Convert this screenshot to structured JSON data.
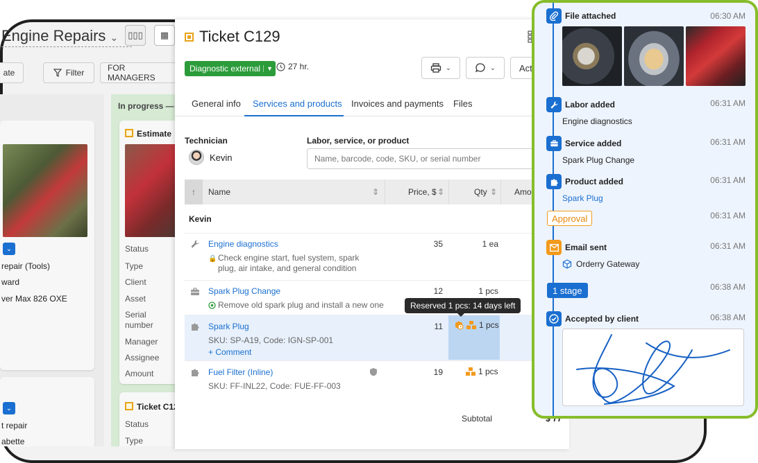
{
  "board": {
    "title": "Engine Repairs",
    "caret": "⌄",
    "view_kanban": "▯▯▯",
    "view_table": "▦",
    "btn_partial": "ate",
    "filter_label": "Filter",
    "managers_label": "FOR MANAGERS",
    "column_in_progress": "In progress —",
    "card_estimate": "Estimate",
    "card_ticket_prefix": "Ticket C12",
    "left_lines": [
      "repair (Tools)",
      "ward",
      "ver Max 826 OXE"
    ],
    "left_bottom_lines": [
      "t repair",
      "abette"
    ],
    "field_labels": [
      "Status",
      "Type",
      "Client",
      "Asset",
      "Serial",
      "number",
      "Manager",
      "Assignee",
      "Amount"
    ],
    "field_labels_bottom": [
      "Status",
      "Type"
    ]
  },
  "ticket": {
    "title": "Ticket C129",
    "status": "Diagnostic external",
    "timer": "27 hr.",
    "actions_label": "Acti",
    "tabs": [
      "General info",
      "Services and products",
      "Invoices and payments",
      "Files"
    ],
    "technician_label": "Technician",
    "technician_name": "Kevin",
    "labor_label": "Labor, service, or product",
    "search_placeholder": "Name, barcode, code, SKU, or serial number",
    "columns": {
      "name": "Name",
      "price": "Price, $",
      "qty": "Qty",
      "amount": "Amo"
    },
    "group": "Kevin",
    "rows": [
      {
        "name": "Engine diagnostics",
        "desc": "Check engine start, fuel system, spark plug, air intake, and general condition",
        "price": "35",
        "qty": "1 ea"
      },
      {
        "name": "Spark Plug Change",
        "desc": "Remove old spark plug and install a new one",
        "price": "12",
        "qty": "1 pcs"
      },
      {
        "name": "Spark Plug",
        "desc": "SKU: SP-A19, Code: IGN-SP-001",
        "comment": "+ Comment",
        "price": "11",
        "qty": "1 pcs"
      },
      {
        "name": "Fuel Filter (Inline)",
        "desc": "SKU: FF-INL22, Code: FUE-FF-003",
        "price": "19",
        "qty": "1 pcs"
      }
    ],
    "tooltip": "Reserved 1 pcs: 14 days left",
    "subtotal_label": "Subtotal",
    "subtotal_value": "$ 77"
  },
  "timeline": {
    "events": [
      {
        "title": "File attached",
        "time": "06:30 AM"
      },
      {
        "title": "Labor added",
        "time": "06:31 AM",
        "sub": "Engine diagnostics"
      },
      {
        "title": "Service added",
        "time": "06:31 AM",
        "sub": "Spark Plug Change"
      },
      {
        "title": "Product added",
        "time": "06:31 AM",
        "sub": "Spark Plug"
      },
      {
        "title": "Approval",
        "time": "06:31 AM"
      },
      {
        "title": "Email sent",
        "time": "06:31 AM",
        "sub": "Orderry Gateway"
      },
      {
        "title": "1 stage",
        "time": "06:38 AM"
      },
      {
        "title": "Accepted by client",
        "time": "06:38 AM"
      }
    ]
  },
  "colors": {
    "brand_blue": "#1a6fd0",
    "status_green": "#2c9c3a",
    "accent_orange": "#f29a1c",
    "frame_green": "#87bd2b"
  }
}
